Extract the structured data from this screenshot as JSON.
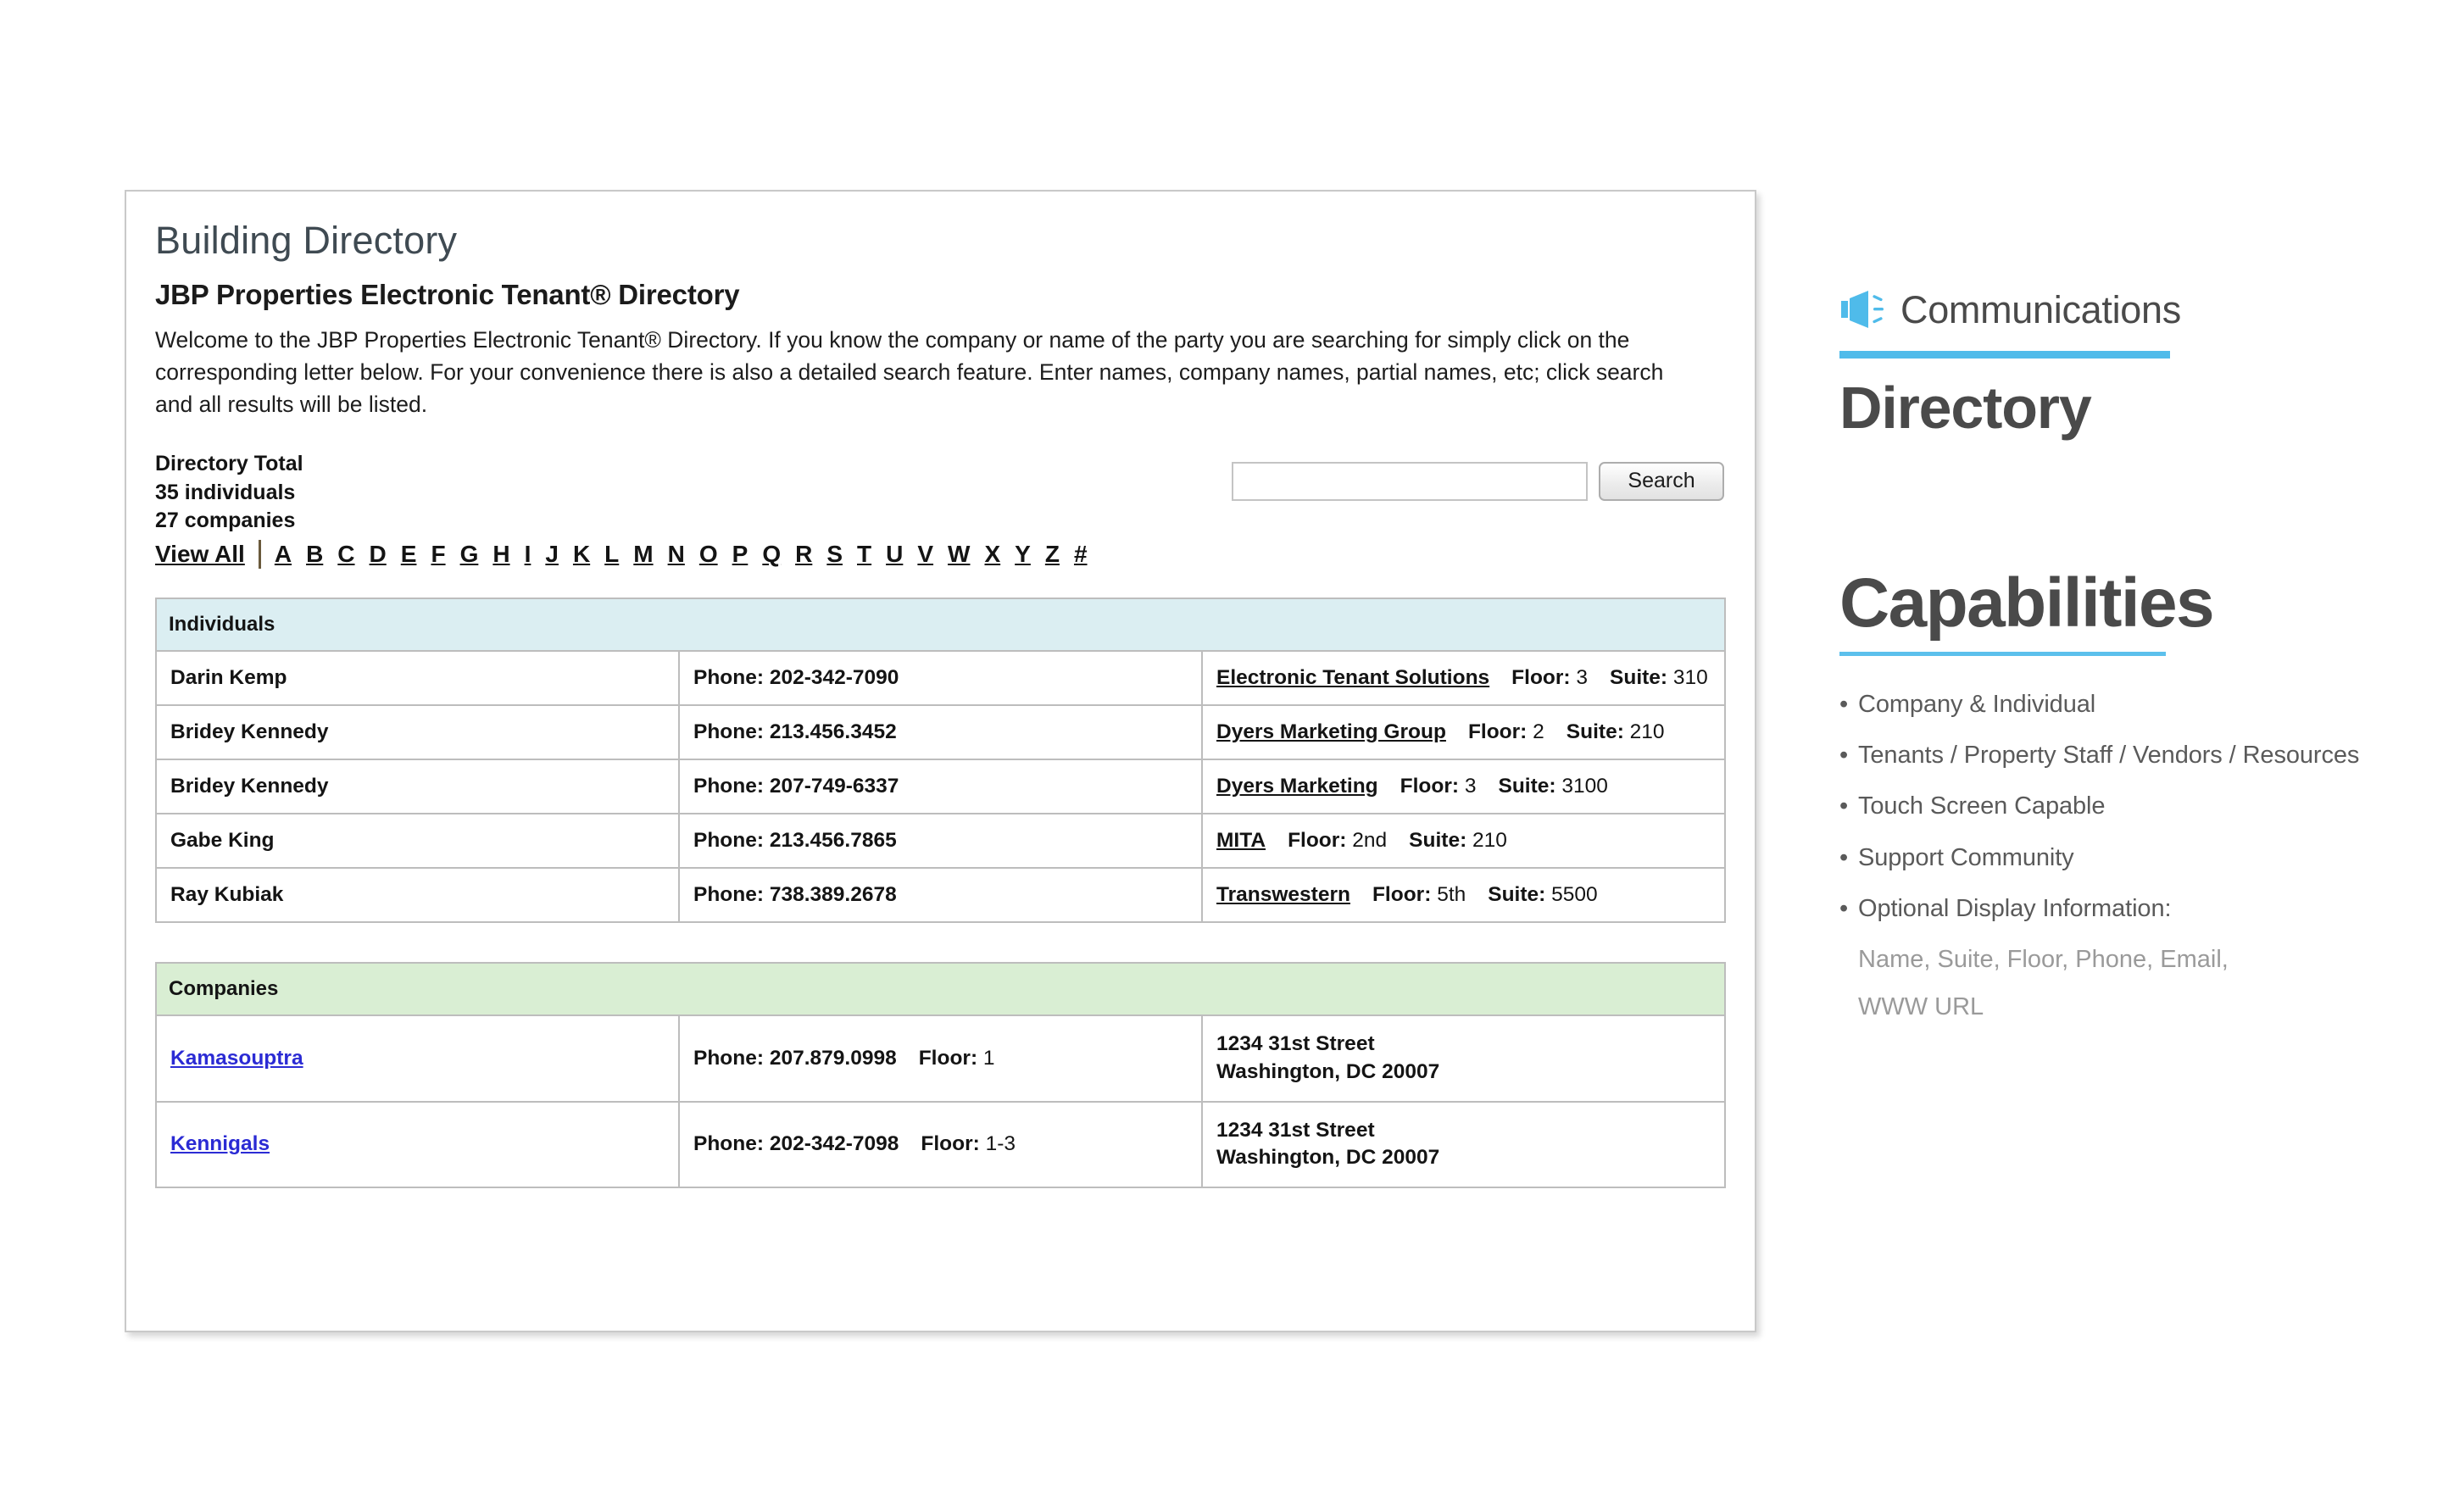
{
  "screenshot": {
    "page_title": "Building Directory",
    "heading": "JBP Properties Electronic Tenant® Directory",
    "intro": "Welcome to the JBP Properties Electronic Tenant® Directory. If you know the company or name of the party you are searching for simply click on the corresponding letter below. For your convenience there is also a detailed search feature. Enter names, company names, partial names, etc; click search and all results will be listed.",
    "totals": {
      "label": "Directory Total",
      "individuals": "35 individuals",
      "companies": "27 companies"
    },
    "search": {
      "value": "",
      "placeholder": "",
      "button_label": "Search"
    },
    "alpha_nav": {
      "view_all": "View All",
      "letters": [
        "A",
        "B",
        "C",
        "D",
        "E",
        "F",
        "G",
        "H",
        "I",
        "J",
        "K",
        "L",
        "M",
        "N",
        "O",
        "P",
        "Q",
        "R",
        "S",
        "T",
        "U",
        "V",
        "W",
        "X",
        "Y",
        "Z",
        "#"
      ]
    },
    "individuals": {
      "section_label": "Individuals",
      "rows": [
        {
          "name": "Darin Kemp",
          "phone": "Phone: 202-342-7090",
          "company": "Electronic Tenant Solutions",
          "floor_label": "Floor:",
          "floor": "3",
          "suite_label": "Suite:",
          "suite": "310"
        },
        {
          "name": "Bridey Kennedy",
          "phone": "Phone: 213.456.3452",
          "company": "Dyers Marketing Group",
          "floor_label": "Floor:",
          "floor": "2",
          "suite_label": "Suite:",
          "suite": "210"
        },
        {
          "name": "Bridey Kennedy",
          "phone": "Phone: 207-749-6337",
          "company": "Dyers Marketing",
          "floor_label": "Floor:",
          "floor": "3",
          "suite_label": "Suite:",
          "suite": "3100"
        },
        {
          "name": "Gabe King",
          "phone": "Phone: 213.456.7865",
          "company": "MITA",
          "floor_label": "Floor:",
          "floor": "2nd",
          "suite_label": "Suite:",
          "suite": "210"
        },
        {
          "name": "Ray Kubiak",
          "phone": "Phone: 738.389.2678",
          "company": "Transwestern",
          "floor_label": "Floor:",
          "floor": "5th",
          "suite_label": "Suite:",
          "suite": "5500"
        }
      ]
    },
    "companies": {
      "section_label": "Companies",
      "rows": [
        {
          "name": "Kamasouptra",
          "phone": "Phone: 207.879.0998",
          "floor_label": "Floor:",
          "floor": "1",
          "address1": "1234 31st Street",
          "address2": "Washington, DC 20007"
        },
        {
          "name": "Kennigals",
          "phone": "Phone: 202-342-7098",
          "floor_label": "Floor:",
          "floor": "1-3",
          "address1": "1234 31st Street",
          "address2": "Washington, DC 20007"
        }
      ]
    }
  },
  "panel": {
    "kicker": "Communications",
    "kicker_icon": "megaphone-icon",
    "title": "Directory",
    "capabilities_title": "Capabilities",
    "bullet_marker": "•",
    "bullets": [
      "Company & Individual",
      "Tenants / Property Staff / Vendors / Resources",
      "Touch Screen Capable",
      "Support Community",
      "Optional Display Information:"
    ],
    "subtext_lines": [
      "Name, Suite, Floor, Phone, Email,",
      "WWW URL"
    ]
  },
  "colors": {
    "accent_blue": "#4fbbea",
    "heading_gray": "#4a4a4a",
    "body_gray": "#5a5a5a",
    "muted_gray": "#9a9a9a",
    "individuals_header_bg": "#dbeef2",
    "companies_header_bg": "#d9eed3",
    "link_blue": "#2b2bd4"
  }
}
